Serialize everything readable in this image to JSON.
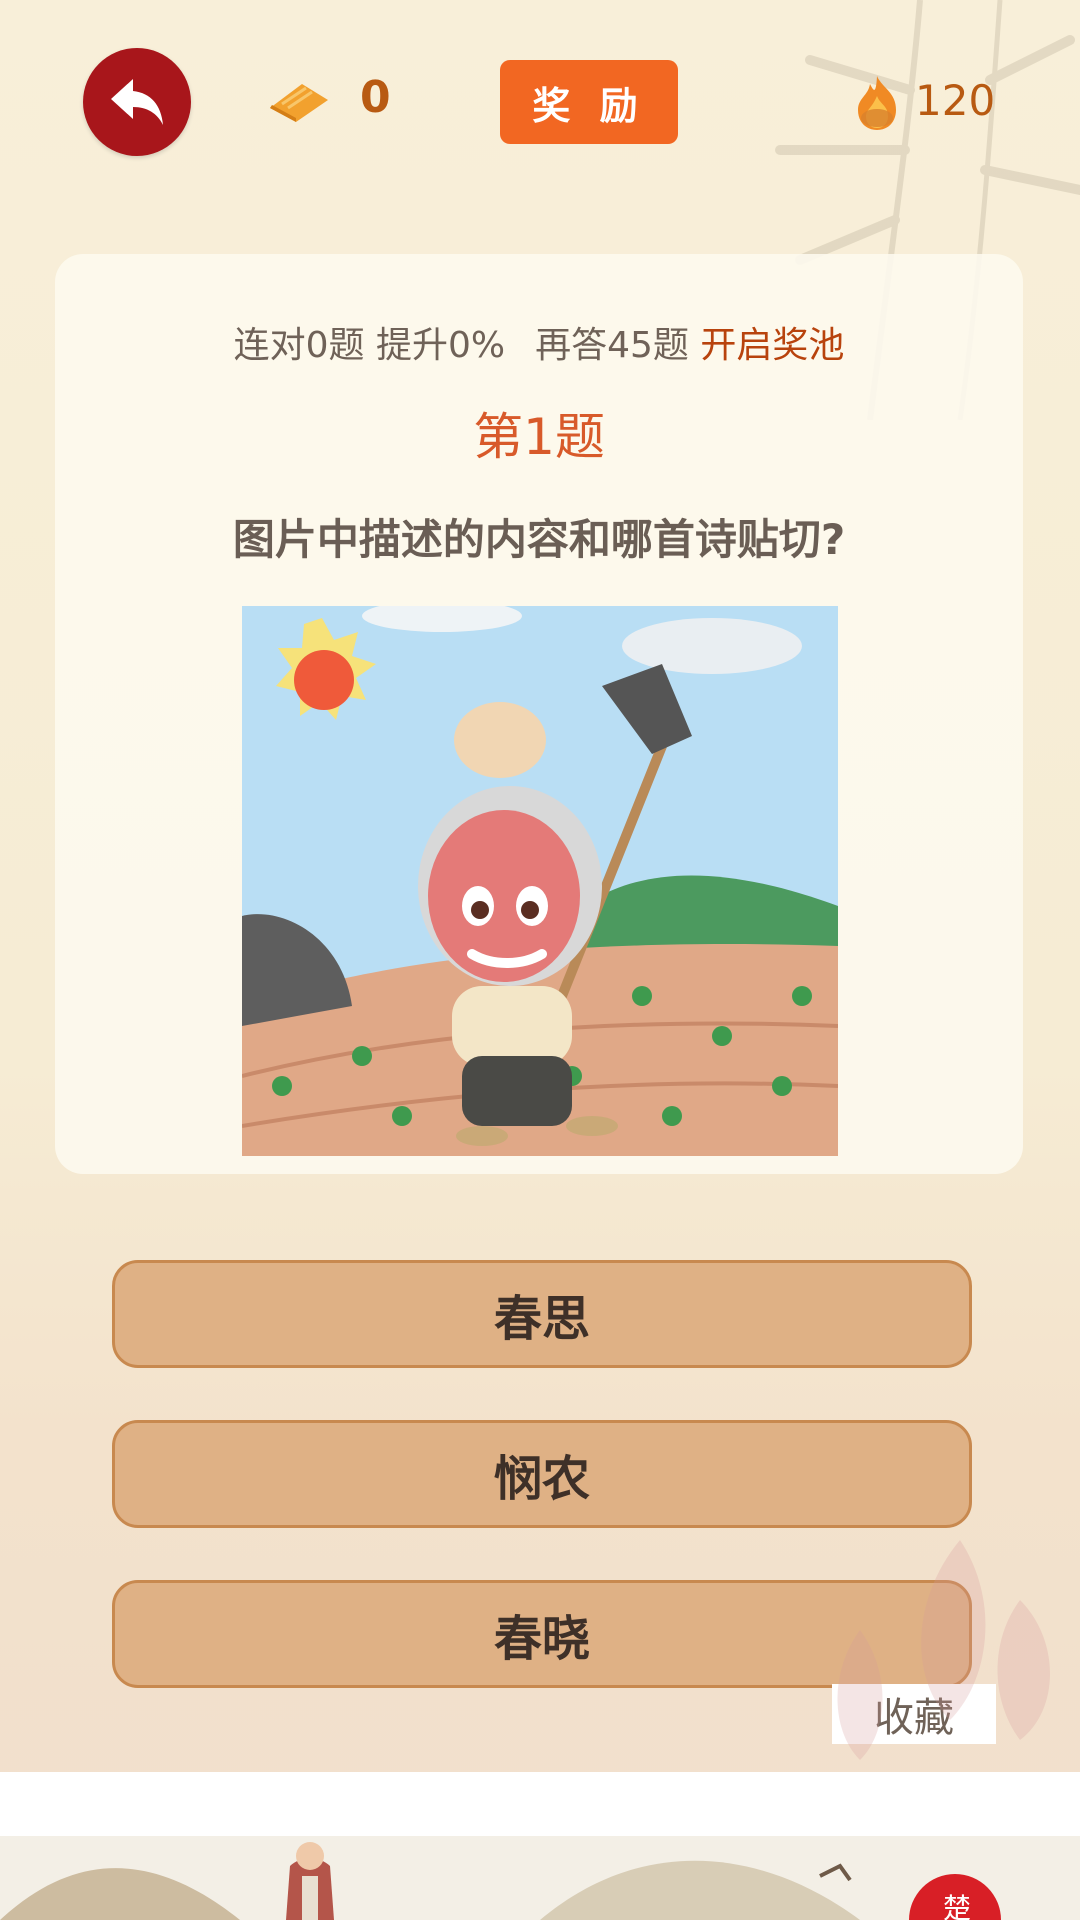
{
  "topbar": {
    "ticket_count": "0",
    "reward_label": "奖 励",
    "flame_count": "120"
  },
  "card": {
    "stats_streak": "连对0题 提升0%",
    "stats_remaining": "再答45题",
    "stats_pool": "开启奖池",
    "question_number": "第1题",
    "question_text": "图片中描述的内容和哪首诗贴切?"
  },
  "answers": [
    {
      "label": "春思"
    },
    {
      "label": "悯农"
    },
    {
      "label": "春晓"
    }
  ],
  "favorite_label": "收藏",
  "banner_badge": "楚",
  "colors": {
    "back_button": "#a8161b",
    "reward_button": "#f26722",
    "accent_text": "#b8430d",
    "answer_fill": "#dfb185"
  }
}
